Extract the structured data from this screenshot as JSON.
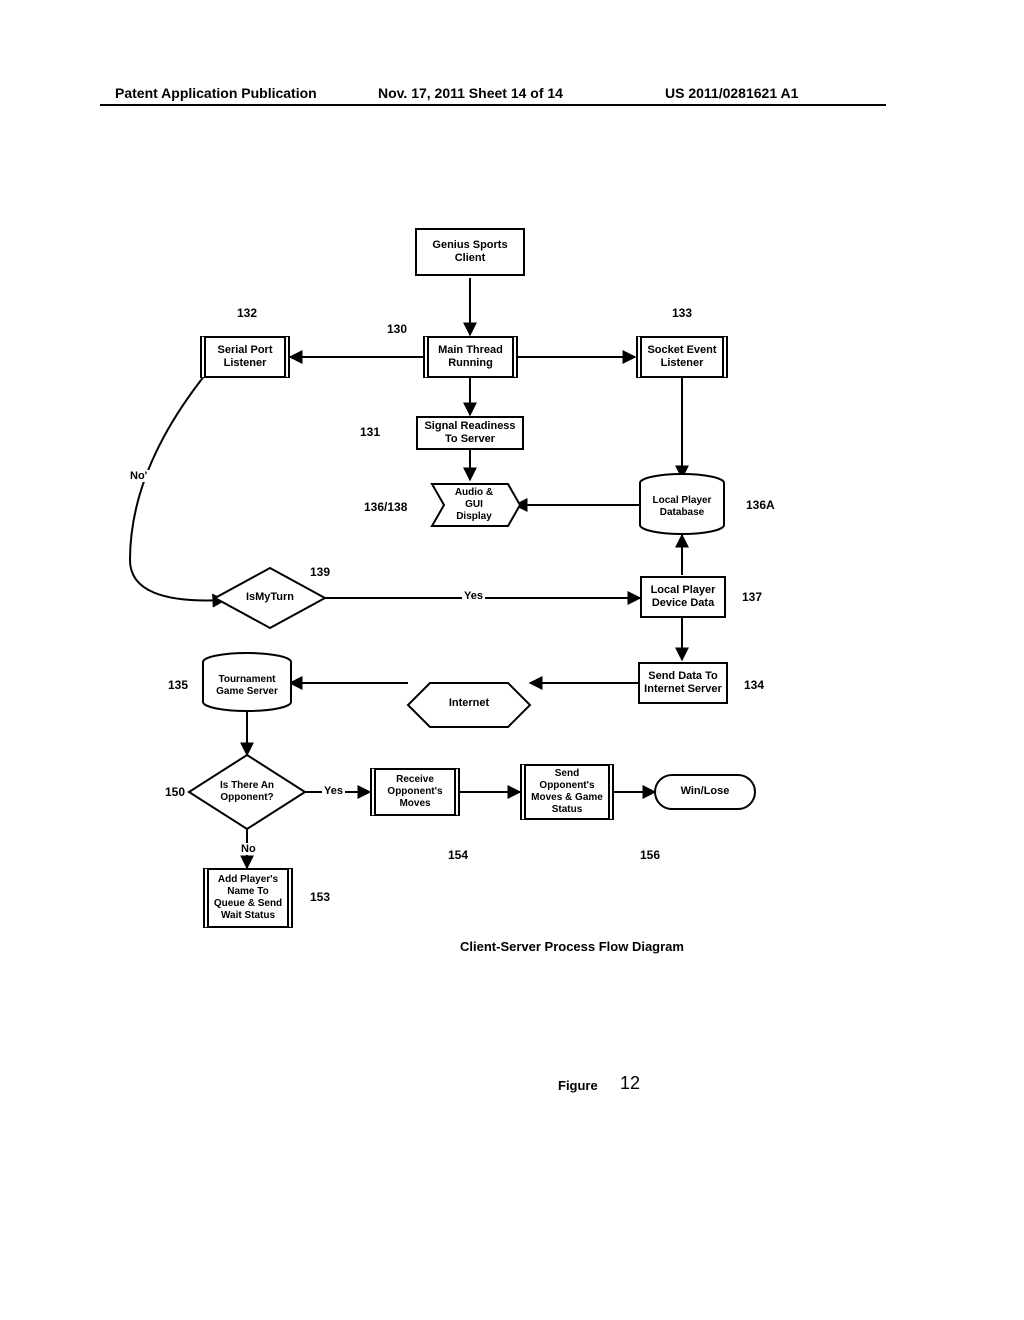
{
  "header": {
    "left": "Patent Application Publication",
    "mid": "Nov. 17, 2011  Sheet 14 of 14",
    "right": "US 2011/0281621 A1"
  },
  "labels": {
    "n130": "130",
    "n131": "131",
    "n132": "132",
    "n133": "133",
    "n134": "134",
    "n135": "135",
    "n136_138": "136/138",
    "n136A": "136A",
    "n137": "137",
    "n139": "139",
    "n150": "150",
    "n153": "153",
    "n154": "154",
    "n156": "156"
  },
  "nodes": {
    "client": "Genius Sports Client",
    "main_thread": "Main Thread Running",
    "serial": "Serial Port Listener",
    "socket": "Socket Event Listener",
    "signal": "Signal Readiness To Server",
    "audio_gui": "Audio & GUI Display",
    "db": "Local Player Database",
    "device_data": "Local Player Device Data",
    "ismyturn": "IsMyTurn",
    "internet": "Internet",
    "tour_server": "Tournament Game Server",
    "send_data": "Send Data To Internet Server",
    "opponent_q": "Is There An Opponent?",
    "recv_moves": "Receive Opponent's Moves",
    "send_moves": "Send Opponent's Moves & Game Status",
    "winlose": "Win/Lose",
    "add_queue": "Add Player's Name To Queue & Send Wait Status"
  },
  "edges": {
    "yes": "Yes",
    "no": "No",
    "no_quote": "No'"
  },
  "caption": "Client-Server Process Flow Diagram",
  "figure_label": "Figure",
  "figure_number": "12"
}
